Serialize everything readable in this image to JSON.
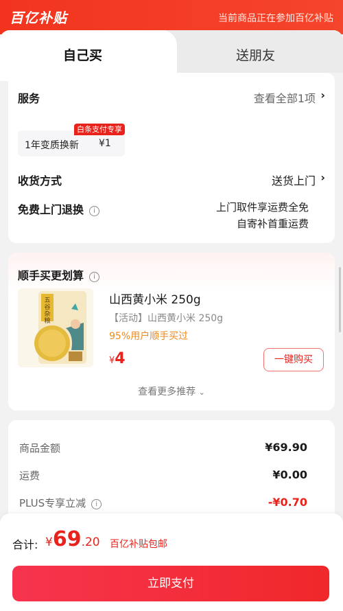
{
  "header": {
    "brand": "百亿补贴",
    "note": "当前商品正在参加百亿补贴"
  },
  "tabs": [
    {
      "label": "自己买",
      "active": true
    },
    {
      "label": "送朋友",
      "active": false
    }
  ],
  "service": {
    "title": "服务",
    "view_all": "查看全部1项",
    "chip_text": "1年变质换新",
    "chip_price": "¥1",
    "chip_tag": "白条支付专享",
    "delivery_label": "收货方式",
    "delivery_value": "送货上门",
    "return_label": "免费上门退换",
    "return_note_1": "上门取件享运费全免",
    "return_note_2": "自寄补首重运费"
  },
  "recommend": {
    "title": "顺手买更划算",
    "product_name": "山西黄小米 250g",
    "product_sub": "【活动】山西黄小米 250g",
    "product_hot": "95%用户顺手买过",
    "price_symbol": "¥",
    "price": "4",
    "buy_label": "一键购买",
    "more_label": "查看更多推荐",
    "image_text": "五谷杂粮"
  },
  "amounts": {
    "rows": [
      {
        "label": "商品金额",
        "value": "¥69.90"
      },
      {
        "label": "运费",
        "value": "¥0.00"
      },
      {
        "label": "PLUS专享立减",
        "value": "-¥0.70"
      }
    ]
  },
  "footer": {
    "total_label": "合计:",
    "currency": "¥",
    "total_int": "69",
    "total_dec": ".20",
    "total_note": "百亿补贴包邮",
    "pay_label": "立即支付"
  },
  "colors": {
    "accent": "#e8231c",
    "orange": "#f08a1e",
    "banner": "#f2341e"
  }
}
